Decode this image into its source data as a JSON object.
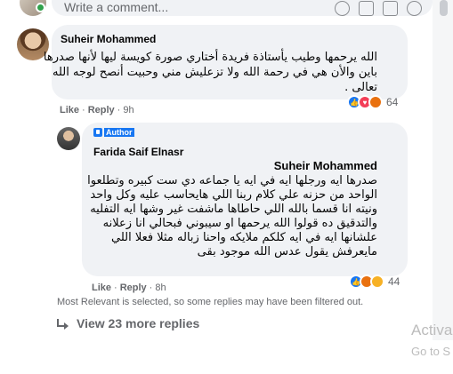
{
  "composer": {
    "placeholder": "Write a comment...",
    "icons": [
      "emoji-icon",
      "camera-icon",
      "gif-icon",
      "sticker-icon"
    ]
  },
  "comment": {
    "author": "Suheir Mohammed",
    "text": "الله يرحمها وطيب يأستاذة فريدة أختاري صورة كويسة ليها لأنها صدرها باين والأن هي في رحمة الله ولا تزعليش مني وحبيت أنصح لوجه الله تعالى .",
    "actions": {
      "like": "Like",
      "reply": "Reply",
      "time": "9h"
    },
    "reactions": {
      "types": [
        "like",
        "love",
        "angry"
      ],
      "count": "64"
    }
  },
  "reply": {
    "badge": "Author",
    "author": "Farida Saif Elnasr",
    "mention": "Suheir Mohammed",
    "text": "صدرها ايه ورجلها ايه في ايه يا جماعه دي ست كبيره وتطلعوا الواحد من حزنه علي كلام ربنا اللي هايحاسب عليه وكل واحد ونيته انا قسما بالله اللي حاطاها ماشفت غير وشها ايه التفليه والتدقيق ده قولوا الله يرحمها او سيبوني فبحالي انا زعلانه علشانها ايه في ايه كلكم ملايكه واحنا زباله مثلا فعلا اللي مايعرفش يقول عدس الله موجود بقى",
    "actions": {
      "like": "Like",
      "reply": "Reply",
      "time": "8h"
    },
    "reactions": {
      "types": [
        "like",
        "angry",
        "haha"
      ],
      "count": "44"
    }
  },
  "filter_note": "Most Relevant is selected, so some replies may have been filtered out.",
  "view_replies": "View 23 more replies",
  "watermark": {
    "line1": "Activa",
    "line2": "Go to S"
  }
}
